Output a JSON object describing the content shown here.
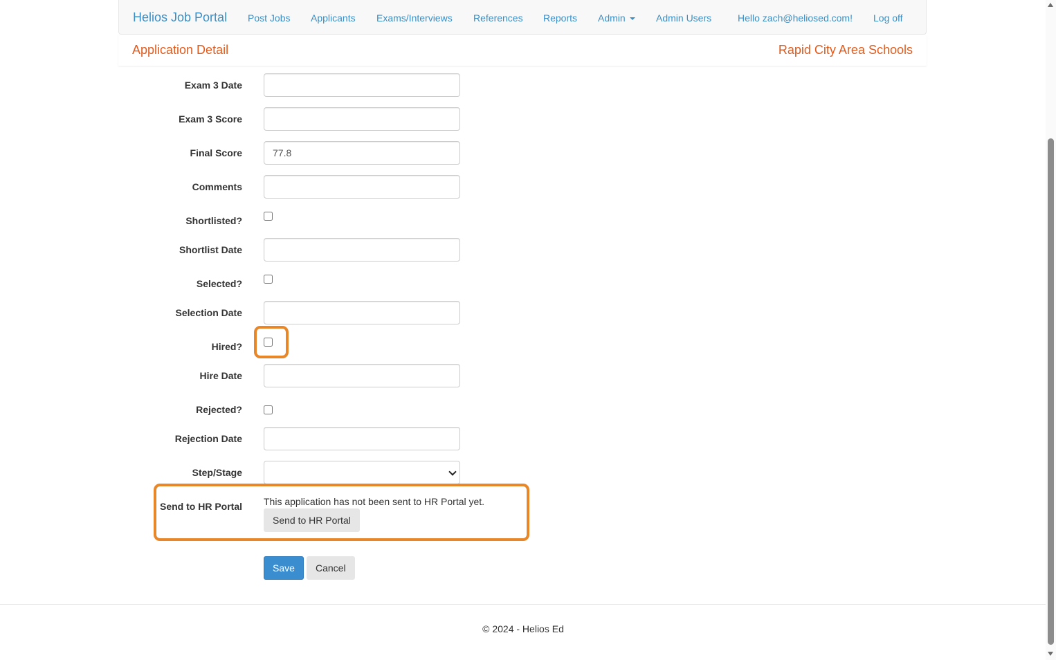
{
  "nav": {
    "brand": "Helios Job Portal",
    "links": [
      "Post Jobs",
      "Applicants",
      "Exams/Interviews",
      "References",
      "Reports",
      "Admin",
      "Admin Users"
    ],
    "greeting": "Hello zach@heliosed.com!",
    "logoff": "Log off"
  },
  "header": {
    "title": "Application Detail",
    "organization": "Rapid City Area Schools"
  },
  "form": {
    "exam3_date": {
      "label": "Exam 3 Date",
      "value": ""
    },
    "exam3_score": {
      "label": "Exam 3 Score",
      "value": ""
    },
    "final_score": {
      "label": "Final Score",
      "value": "77.8"
    },
    "comments": {
      "label": "Comments",
      "value": ""
    },
    "shortlisted": {
      "label": "Shortlisted?",
      "checked": false
    },
    "shortlist_date": {
      "label": "Shortlist Date",
      "value": ""
    },
    "selected": {
      "label": "Selected?",
      "checked": false
    },
    "selection_date": {
      "label": "Selection Date",
      "value": ""
    },
    "hired": {
      "label": "Hired?",
      "checked": false
    },
    "hire_date": {
      "label": "Hire Date",
      "value": ""
    },
    "rejected": {
      "label": "Rejected?",
      "checked": false
    },
    "rejection_date": {
      "label": "Rejection Date",
      "value": ""
    },
    "step_stage": {
      "label": "Step/Stage",
      "value": ""
    },
    "send_hr": {
      "label": "Send to HR Portal",
      "status": "This application has not been sent to HR Portal yet.",
      "button": "Send to HR Portal"
    },
    "save": "Save",
    "cancel": "Cancel"
  },
  "highlight_color": "#e8862a",
  "footer": "© 2024 - Helios Ed"
}
